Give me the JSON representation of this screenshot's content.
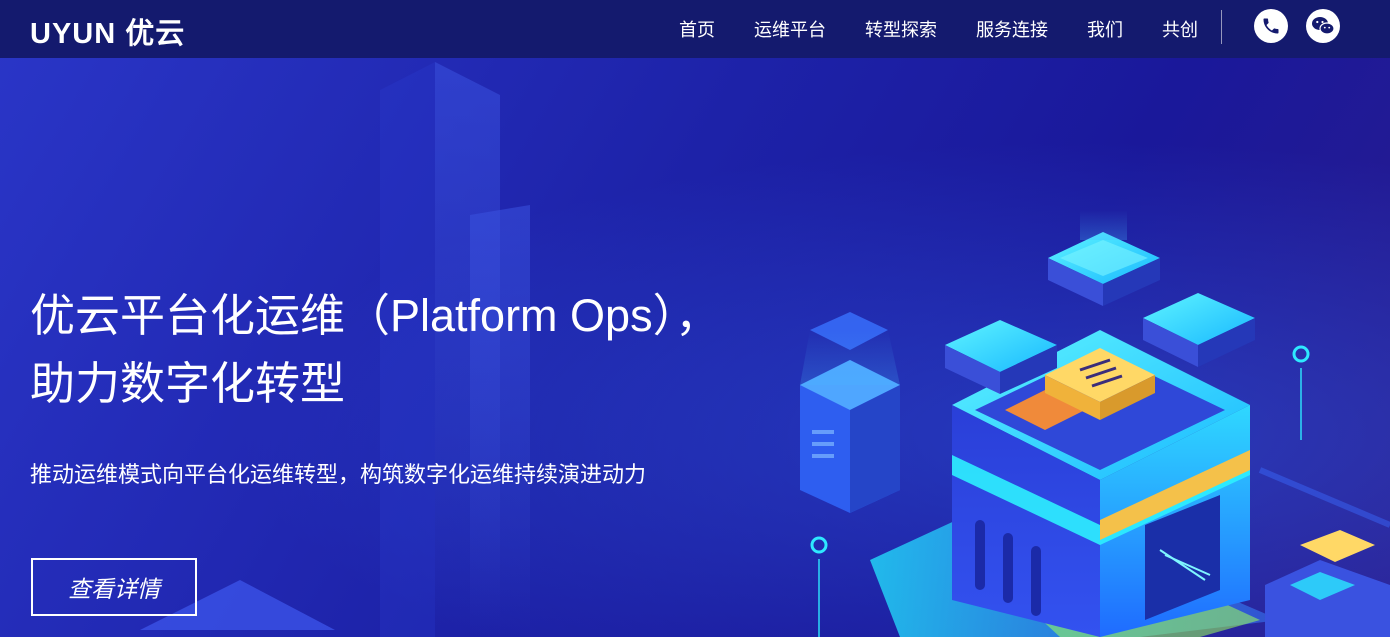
{
  "brand": {
    "logo_text": "UYUN 优云"
  },
  "nav": {
    "items": [
      {
        "label": "首页"
      },
      {
        "label": "运维平台"
      },
      {
        "label": "转型探索"
      },
      {
        "label": "服务连接"
      },
      {
        "label": "我们"
      },
      {
        "label": "共创"
      }
    ],
    "phone_icon": "phone-icon",
    "wechat_icon": "wechat-icon"
  },
  "hero": {
    "title_line1": "优云平台化运维（Platform Ops），",
    "title_line2": "助力数字化转型",
    "subtitle": "推动运维模式向平台化运维转型，构筑数字化运维持续演进动力",
    "cta_label": "查看详情"
  },
  "colors": {
    "navbar_bg": "#141a6e",
    "hero_bg": "#1d22a8",
    "accent_cyan": "#1fe6ff",
    "accent_yellow": "#f4c14a"
  }
}
